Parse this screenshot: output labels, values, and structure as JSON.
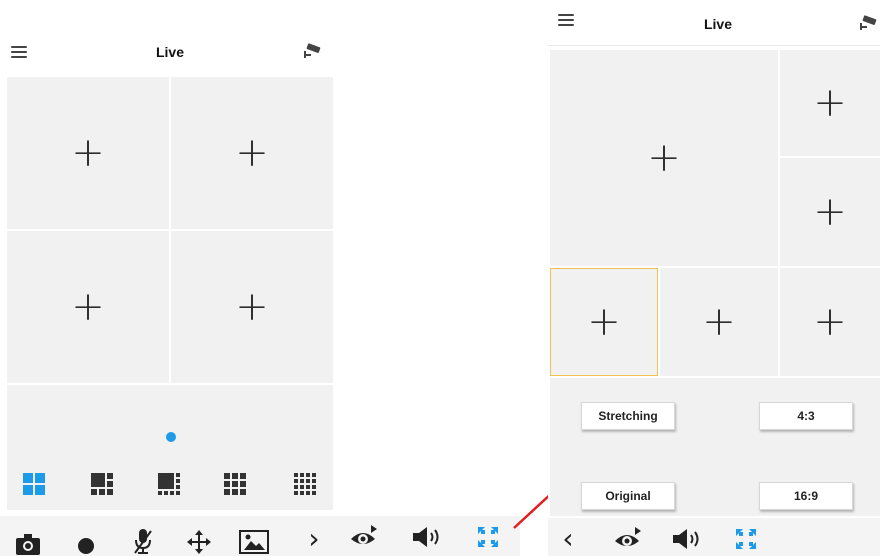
{
  "left_screen": {
    "header": {
      "title": "Live",
      "menu_icon": "hamburger-menu-icon",
      "camera_icon": "cctv-camera-icon"
    },
    "grid_cells": [
      {
        "label": "+"
      },
      {
        "label": "+"
      },
      {
        "label": "+"
      },
      {
        "label": "+"
      }
    ],
    "page_indicator": {
      "pages": 1,
      "active": 1
    },
    "layout_options": [
      {
        "icon": "layout-4-icon",
        "selected": true
      },
      {
        "icon": "layout-6-icon",
        "selected": false
      },
      {
        "icon": "layout-8-icon",
        "selected": false
      },
      {
        "icon": "layout-9-icon",
        "selected": false
      },
      {
        "icon": "layout-16-icon",
        "selected": false
      }
    ],
    "toolbar": [
      {
        "icon": "snapshot-camera-icon"
      },
      {
        "icon": "record-icon"
      },
      {
        "icon": "microphone-mute-icon"
      },
      {
        "icon": "ptz-move-icon"
      },
      {
        "icon": "image-adjust-icon"
      },
      {
        "icon": "chevron-right-icon",
        "label": "›"
      }
    ]
  },
  "middle_toolbar": [
    {
      "icon": "preview-eye-icon"
    },
    {
      "icon": "speaker-audio-icon"
    },
    {
      "icon": "fullscreen-icon"
    }
  ],
  "right_screen": {
    "header": {
      "title": "Live",
      "menu_icon": "hamburger-menu-icon",
      "camera_icon": "cctv-camera-icon"
    },
    "grid_cells": [
      {
        "label": "+"
      },
      {
        "label": "+"
      },
      {
        "label": "+"
      },
      {
        "label": "+"
      },
      {
        "label": "+"
      },
      {
        "label": "+"
      }
    ],
    "aspect_buttons": {
      "stretching": "Stretching",
      "ratio_4_3": "4:3",
      "original": "Original",
      "ratio_16_9": "16:9"
    },
    "toolbar": [
      {
        "icon": "chevron-left-icon",
        "label": "‹"
      },
      {
        "icon": "preview-eye-icon"
      },
      {
        "icon": "speaker-audio-icon"
      },
      {
        "icon": "fullscreen-icon"
      }
    ]
  },
  "colors": {
    "accent_blue": "#1e9be8",
    "selected_border": "#f2c14e",
    "arrow_red": "#e02020",
    "cell_bg": "#f1f1f1",
    "icon_dark": "#2d2d2d"
  }
}
